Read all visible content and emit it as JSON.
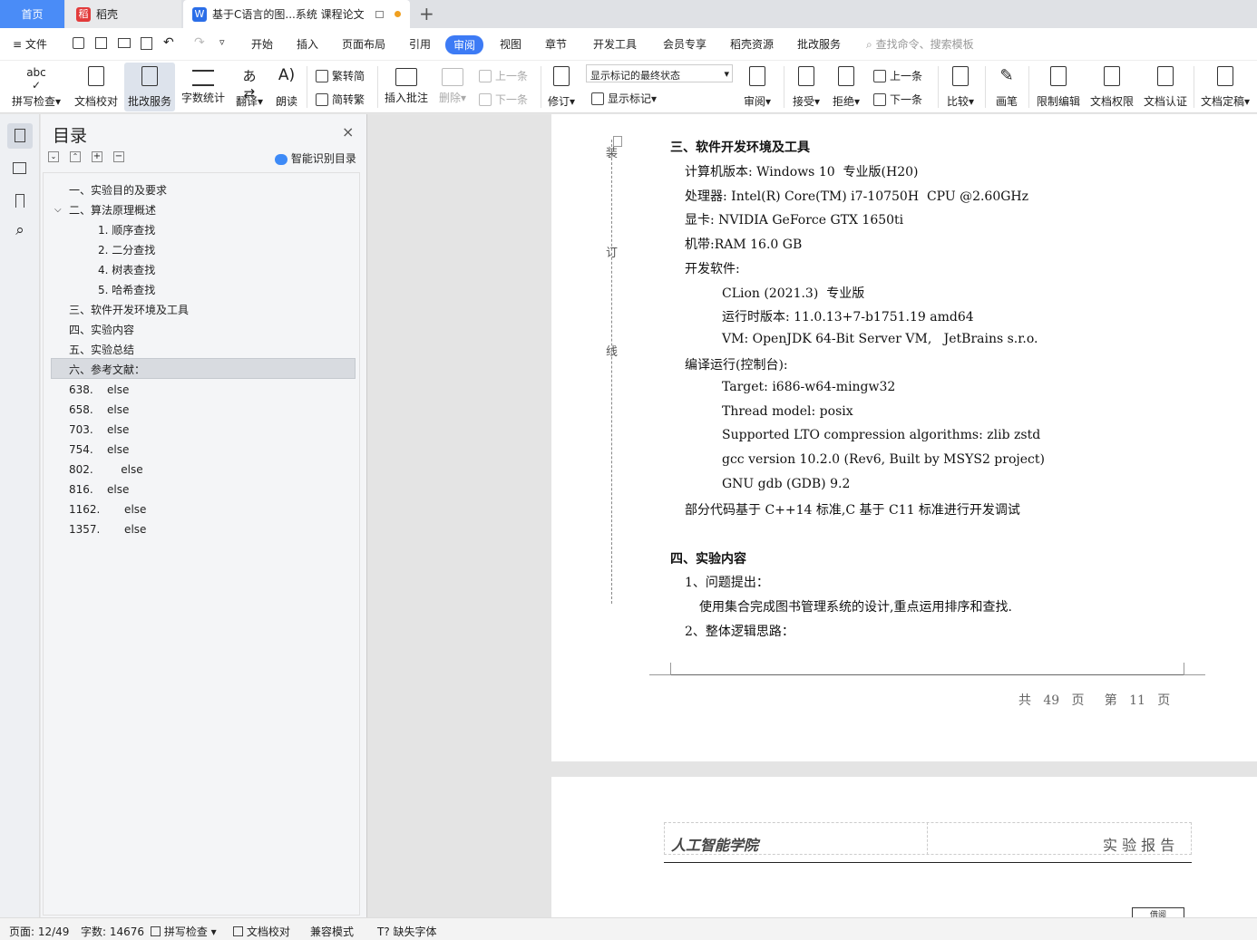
{
  "tabs": {
    "home": "首页",
    "docer": "稻壳",
    "doc": "基于C语言的图...系统 课程论文"
  },
  "menu": {
    "file": "文件",
    "items": [
      "开始",
      "插入",
      "页面布局",
      "引用",
      "审阅",
      "视图",
      "章节",
      "开发工具",
      "会员专享",
      "稻壳资源",
      "批改服务"
    ],
    "search": "查找命令、搜索模板"
  },
  "ribbon": {
    "spell": "拼写检查",
    "proof": "文档校对",
    "correct": "批改服务",
    "wordcount": "字数统计",
    "translate": "翻译",
    "read": "朗读",
    "trad2simp": "繁转简",
    "simp2trad": "简转繁",
    "insert_comment": "插入批注",
    "delete": "删除",
    "prev": "上一条",
    "next": "下一条",
    "track": "修订",
    "markup_state": "显示标记的最终状态",
    "show_markup": "显示标记",
    "review": "审阅",
    "accept": "接受",
    "reject": "拒绝",
    "prev2": "上一条",
    "next2": "下一条",
    "compare": "比较",
    "pen": "画笔",
    "restrict": "限制编辑",
    "perm": "文档权限",
    "cert": "文档认证",
    "finalize": "文档定稿"
  },
  "toc": {
    "title": "目录",
    "smart": "智能识别目录",
    "items": [
      "一、实验目的及要求",
      "二、算法原理概述",
      "1. 顺序查找",
      "2. 二分查找",
      "4. 树表查找",
      "5. 哈希查找",
      "三、软件开发环境及工具",
      "四、实验内容",
      "五、实验总结",
      "六、参考文献：",
      "638.    else",
      "658.    else",
      "703.    else",
      "754.    else",
      "802.        else",
      "816.    else",
      "1162.       else",
      "1357.       else"
    ]
  },
  "doc": {
    "margin_marks": [
      "装",
      "订",
      "线"
    ],
    "h3": "三、软件开发环境及工具",
    "lines": [
      "计算机版本: Windows 10  专业版(H20)",
      "处理器: Intel(R) Core(TM) i7-10750H  CPU @2.60GHz",
      "显卡: NVIDIA GeForce GTX 1650ti",
      "机带:RAM 16.0 GB",
      "开发软件:",
      "CLion (2021.3)  专业版",
      "运行时版本: 11.0.13+7-b1751.19 amd64",
      "VM: OpenJDK 64-Bit Server VM,   JetBrains s.r.o.",
      "编译运行(控制台):",
      "Target: i686-w64-mingw32",
      "Thread model: posix",
      "Supported LTO compression algorithms: zlib zstd",
      "gcc version 10.2.0 (Rev6, Built by MSYS2 project)",
      "GNU gdb (GDB) 9.2",
      "部分代码基于 C++14 标准,C 基于 C11 标准进行开发调试"
    ],
    "h4": "四、实验内容",
    "q1": "1、问题提出：",
    "q1_text": "使用集合完成图书管理系统的设计,重点运用排序和查找.",
    "q2": "2、整体逻辑思路：",
    "footer": "共   49   页     第   11   页",
    "header_left": "人工智能学院",
    "header_right": "实 验 报 告",
    "next_page_tag": "借阅"
  },
  "status": {
    "page": "页面: 12/49",
    "words": "字数: 14676",
    "spell": "拼写检查",
    "proof": "文档校对",
    "compat": "兼容模式",
    "missing_font": "缺失字体"
  }
}
